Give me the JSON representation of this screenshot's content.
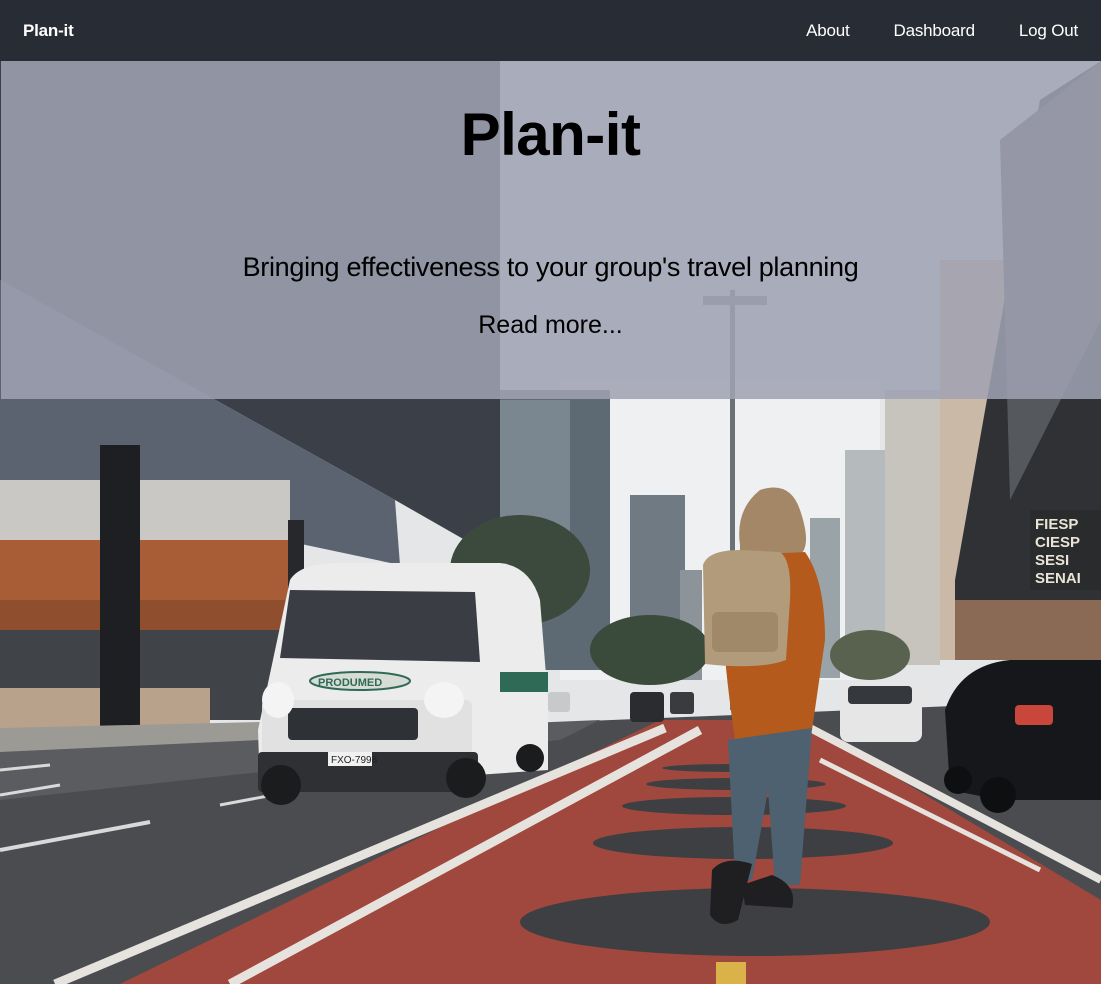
{
  "navbar": {
    "brand": "Plan-it",
    "links": [
      {
        "label": "About"
      },
      {
        "label": "Dashboard"
      },
      {
        "label": "Log Out"
      }
    ]
  },
  "hero": {
    "title": "Plan-it",
    "tagline": "Bringing effectiveness to your group's travel planning",
    "read_more": "Read more...",
    "photo_signs": {
      "van_brand": "PRODUMED",
      "van_plate": "FXO-7998",
      "building_sign": [
        "FIESP",
        "CIESP",
        "SESI",
        "SENAI"
      ]
    }
  },
  "colors": {
    "navbar_bg": "#282c34",
    "overlay": "rgba(160,162,178,0.86)",
    "bike_lane": "#a0483d"
  }
}
